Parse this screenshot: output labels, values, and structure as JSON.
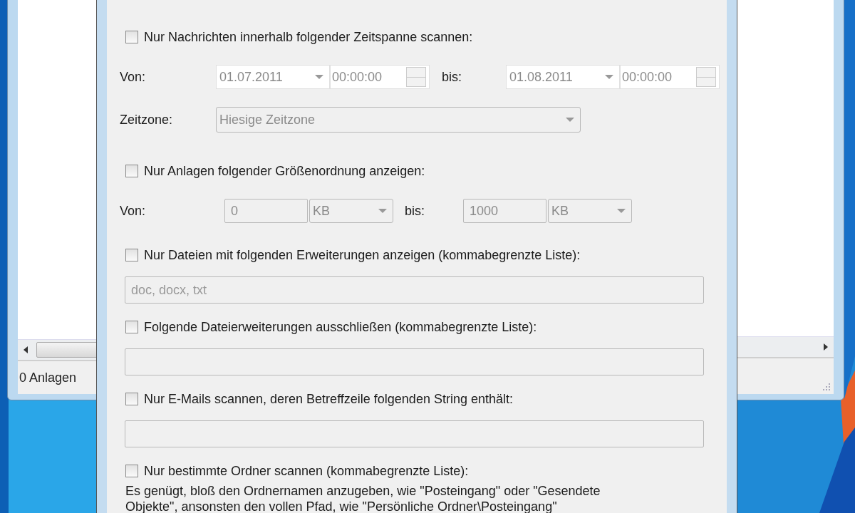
{
  "left_window": {
    "status_text": "0 Anlagen"
  },
  "dialog": {
    "sections": [
      {
        "kind": "checkbox",
        "label": "Nur Nachrichten innerhalb folgender Zeitspanne scannen:",
        "checked": false
      },
      {
        "kind": "date_range",
        "from_label": "Von:",
        "from_date": "01.07.2011",
        "from_time": "00:00:00",
        "to_label": "bis:",
        "to_date": "01.08.2011",
        "to_time": "00:00:00",
        "disabled": true
      },
      {
        "kind": "combo",
        "label": "Zeitzone:",
        "value": "Hiesige Zeitzone",
        "disabled": true
      },
      {
        "kind": "checkbox",
        "label": "Nur Anlagen folgender Größenordnung anzeigen:",
        "checked": false
      },
      {
        "kind": "size_range",
        "from_label": "Von:",
        "from_value": "0",
        "from_unit": "KB",
        "to_label": "bis:",
        "to_value": "1000",
        "to_unit": "KB",
        "disabled": true
      },
      {
        "kind": "checkbox",
        "label": "Nur Dateien mit folgenden Erweiterungen anzeigen (kommabegrenzte Liste):",
        "checked": false
      },
      {
        "kind": "text_field",
        "placeholder": "doc, docx, txt",
        "disabled": true
      },
      {
        "kind": "checkbox",
        "label": "Folgende Dateierweiterungen ausschließen (kommabegrenzte Liste):",
        "checked": false
      },
      {
        "kind": "text_field",
        "disabled": true
      },
      {
        "kind": "checkbox",
        "label": "Nur E-Mails scannen, deren Betreffzeile folgenden String enthält:",
        "checked": false
      },
      {
        "kind": "text_field",
        "disabled": true
      },
      {
        "kind": "checkbox",
        "label": "Nur bestimmte Ordner scannen (kommabegrenzte Liste):",
        "checked": false
      },
      {
        "kind": "note",
        "text": "Es genügt, bloß den Ordnernamen anzugeben, wie \"Posteingang\" oder \"Gesendete Objekte\", ansonsten den vollen Pfad, wie \"Persönliche Ordner\\Posteingang\""
      }
    ]
  }
}
